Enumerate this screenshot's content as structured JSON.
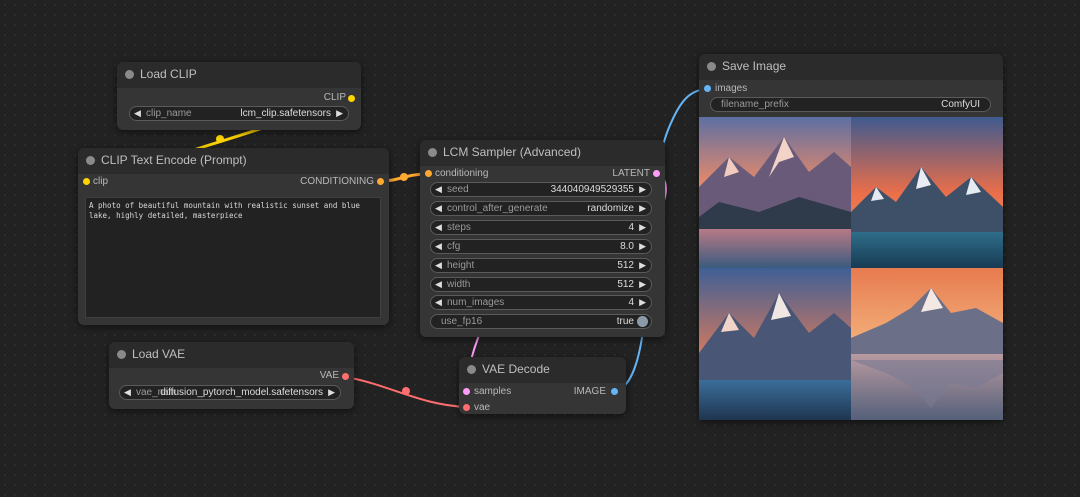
{
  "nodes": {
    "load_clip": {
      "title": "Load CLIP",
      "output": "CLIP",
      "widget": {
        "name": "clip_name",
        "value": "lcm_clip.safetensors"
      }
    },
    "clip_text_encode": {
      "title": "CLIP Text Encode (Prompt)",
      "input": "clip",
      "output": "CONDITIONING",
      "prompt": "A photo of beautiful mountain with realistic sunset and blue lake, highly detailed, masterpiece"
    },
    "lcm_sampler": {
      "title": "LCM Sampler (Advanced)",
      "input": "conditioning",
      "output": "LATENT",
      "widgets": [
        {
          "name": "seed",
          "value": "344040949529355"
        },
        {
          "name": "control_after_generate",
          "value": "randomize"
        },
        {
          "name": "steps",
          "value": "4"
        },
        {
          "name": "cfg",
          "value": "8.0"
        },
        {
          "name": "height",
          "value": "512"
        },
        {
          "name": "width",
          "value": "512"
        },
        {
          "name": "num_images",
          "value": "4"
        }
      ],
      "toggle": {
        "name": "use_fp16",
        "value": "true"
      }
    },
    "load_vae": {
      "title": "Load VAE",
      "output": "VAE",
      "widget": {
        "name": "vae_name",
        "value": "diffusion_pytorch_model.safetensors"
      }
    },
    "vae_decode": {
      "title": "VAE Decode",
      "inputs": [
        "samples",
        "vae"
      ],
      "output": "IMAGE"
    },
    "save_image": {
      "title": "Save Image",
      "input": "images",
      "widget": {
        "name": "filename_prefix",
        "value": "ComfyUI"
      },
      "image_count": 4
    }
  },
  "colors": {
    "background": "#222222",
    "node": "#353535",
    "clip_link": "#ffd500",
    "conditioning_link": "#ffa931",
    "latent_link": "#ff9cf9",
    "vae_link": "#ff6e6e",
    "image_link": "#64b5f6"
  },
  "icons": {
    "decrement": "left-triangle",
    "increment": "right-triangle"
  }
}
